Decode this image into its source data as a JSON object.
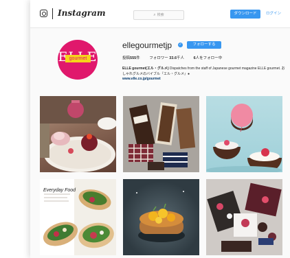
{
  "header": {
    "brand": "Instagram",
    "search_placeholder": "検索",
    "download_button": "ダウンロード",
    "login_link": "ログイン"
  },
  "profile": {
    "avatar_logo_text": "ELLE",
    "avatar_sub_text": "gourmet",
    "username": "ellegourmetjp",
    "follow_button": "フォローする",
    "stats": {
      "posts_label": "投稿",
      "posts_value": "555",
      "posts_unit": "件",
      "followers_label": "フォロワー",
      "followers_value": "33.6",
      "followers_unit": "千人",
      "following_value": "6",
      "following_label": "人をフォロー中"
    },
    "bio_name": "ELLE gourmet(エル・グルメ)",
    "bio_text": "Dispatches from the staff of Japanese gourmet magazine ELLE gourmet. おしゃれグルメのバイブル『エル・グルメ』●",
    "bio_link": "www.elle.co.jp/gourmet"
  },
  "colors": {
    "accent": "#3897f0",
    "brand_pink": "#e0186c",
    "brand_yellow": "#f6d51a"
  },
  "posts": [
    {
      "subject": "afternoon-tea-cakes"
    },
    {
      "subject": "chocolate-bars"
    },
    {
      "subject": "chocolate-balloon-cups"
    },
    {
      "subject": "tacos-magazine-page",
      "caption": "Everyday Food"
    },
    {
      "subject": "citrus-tart"
    },
    {
      "subject": "chocolate-bonbons"
    }
  ]
}
